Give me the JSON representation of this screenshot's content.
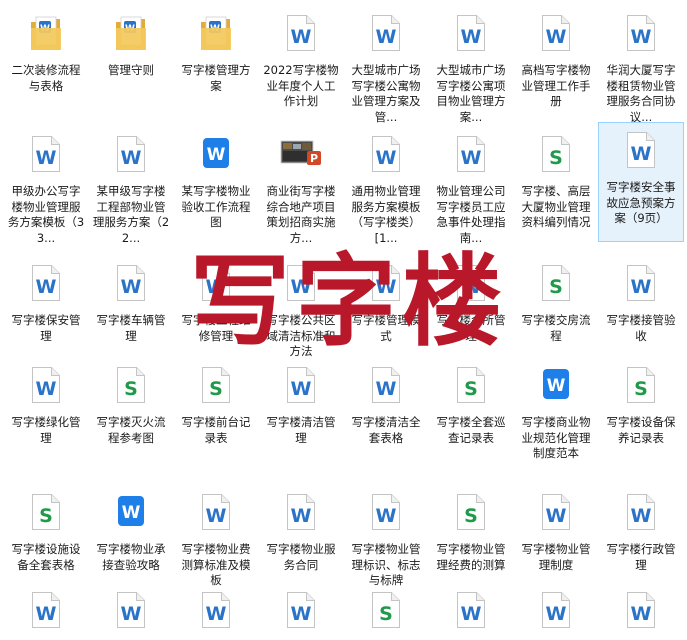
{
  "watermark": "写字楼",
  "colors": {
    "word": "#2b73c8",
    "wps_word": "#1e7fe8",
    "sheet": "#1f9a4b",
    "ppt": "#d24726",
    "folder": "#f4c95d",
    "watermark": "#b8182a"
  },
  "items": [
    {
      "label": "二次装修流程与表格",
      "icon": "folder-docs"
    },
    {
      "label": "管理守则",
      "icon": "folder-docs"
    },
    {
      "label": "写字楼管理方案",
      "icon": "folder-docs"
    },
    {
      "label": "2022写字楼物业年度个人工作计划",
      "icon": "word"
    },
    {
      "label": "大型城市广场写字楼公寓物业管理方案及管...",
      "icon": "word"
    },
    {
      "label": "大型城市广场写字楼公寓项目物业管理方案...",
      "icon": "word"
    },
    {
      "label": "高档写字楼物业管理工作手册",
      "icon": "word"
    },
    {
      "label": "华润大厦写字楼租赁物业管理服务合同协议...",
      "icon": "word"
    },
    {
      "label": "甲级办公写字楼物业管理服务方案模板（33...",
      "icon": "word"
    },
    {
      "label": "某甲级写字楼工程部物业管理服务方案（22...",
      "icon": "word"
    },
    {
      "label": "某写字楼物业验收工作流程图",
      "icon": "wps-word"
    },
    {
      "label": "商业街写字楼综合地产项目策划招商实施方...",
      "icon": "ppt"
    },
    {
      "label": "通用物业管理服务方案模板（写字楼类）[1...",
      "icon": "word"
    },
    {
      "label": "物业管理公司写字楼员工应急事件处理指南...",
      "icon": "word"
    },
    {
      "label": "写字楼、高层大厦物业管理资料编列情况",
      "icon": "sheet"
    },
    {
      "label": "写字楼安全事故应急预案方案（9页）",
      "icon": "word",
      "selected": true
    },
    {
      "label": "写字楼保安管理",
      "icon": "word"
    },
    {
      "label": "写字楼车辆管理",
      "icon": "word"
    },
    {
      "label": "写字楼工程维修管理",
      "icon": "word"
    },
    {
      "label": "写字楼公共区域清洁标准和方法",
      "icon": "word"
    },
    {
      "label": "写字楼管理模式",
      "icon": "word"
    },
    {
      "label": "写字楼会所管理",
      "icon": "word"
    },
    {
      "label": "写字楼交房流程",
      "icon": "sheet"
    },
    {
      "label": "写字楼接管验收",
      "icon": "word"
    },
    {
      "label": "写字楼绿化管理",
      "icon": "word"
    },
    {
      "label": "写字楼灭火流程参考图",
      "icon": "sheet"
    },
    {
      "label": "写字楼前台记录表",
      "icon": "sheet"
    },
    {
      "label": "写字楼清洁管理",
      "icon": "word"
    },
    {
      "label": "写字楼清洁全套表格",
      "icon": "word"
    },
    {
      "label": "写字楼全套巡查记录表",
      "icon": "sheet"
    },
    {
      "label": "写字楼商业物业规范化管理制度范本",
      "icon": "wps-word"
    },
    {
      "label": "写字楼设备保养记录表",
      "icon": "sheet"
    },
    {
      "label": "写字楼设施设备全套表格",
      "icon": "sheet"
    },
    {
      "label": "写字楼物业承接查验攻略",
      "icon": "wps-word"
    },
    {
      "label": "写字楼物业费测算标准及模板",
      "icon": "word"
    },
    {
      "label": "写字楼物业服务合同",
      "icon": "word"
    },
    {
      "label": "写字楼物业管理标识、标志与标牌",
      "icon": "word"
    },
    {
      "label": "写字楼物业管理经费的测算",
      "icon": "sheet"
    },
    {
      "label": "写字楼物业管理制度",
      "icon": "word"
    },
    {
      "label": "写字楼行政管理",
      "icon": "word"
    },
    {
      "label": "",
      "icon": "word"
    },
    {
      "label": "",
      "icon": "word"
    },
    {
      "label": "",
      "icon": "word"
    },
    {
      "label": "",
      "icon": "word"
    },
    {
      "label": "",
      "icon": "sheet"
    },
    {
      "label": "",
      "icon": "word"
    },
    {
      "label": "",
      "icon": "word"
    },
    {
      "label": "",
      "icon": "word"
    }
  ]
}
